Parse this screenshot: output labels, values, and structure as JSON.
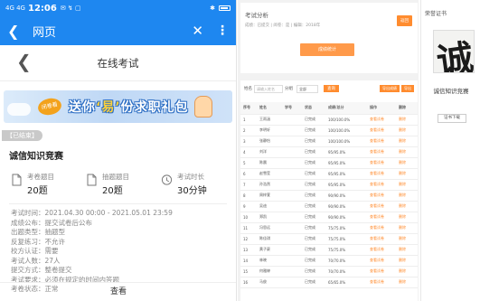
{
  "status_bar": {
    "signal": "4G 4G",
    "time": "12:06",
    "extra": "✉ ↯ ▢"
  },
  "nav": {
    "title": "网页"
  },
  "page": {
    "title": "在线考试"
  },
  "banner": {
    "tag": "闭卷看",
    "slogan_a": "送你",
    "slogan_b": "‘易’",
    "slogan_c": "份求职礼包"
  },
  "exam": {
    "status": "已结束",
    "name": "诚信知识竞赛",
    "stats": [
      {
        "label": "考卷题目",
        "value": "20",
        "unit": "题"
      },
      {
        "label": "抽题题目",
        "value": "20",
        "unit": "题"
      },
      {
        "label": "考试时长",
        "value": "30",
        "unit": "分钟"
      }
    ],
    "info": [
      "考试时间：2021.04.30 00:00 - 2021.05.01 23:59",
      "成绩公布：提交试卷后公布",
      "出题类型：抽题型",
      "反复练习：不允许",
      "校方认证：需要",
      "考试人数：27人",
      "提交方式：整卷提交",
      "考试要求：必须在规定的时间内答题",
      "考卷状态：正常"
    ],
    "view_button": "查看"
  },
  "admin": {
    "analysis_title": "考试分析",
    "analysis_sub": "成绩：已提交 | 阅卷：是 | 编辑：2018年",
    "top_button": "返回",
    "main_button": "成绩统计",
    "filter_label": "姓名",
    "filter_placeholder": "请输入姓名",
    "filter_label2": "分组",
    "filter_select": "全部",
    "search_button": "查询",
    "export_button": "导出成绩",
    "export_button2": "导出",
    "columns": [
      "序号",
      "姓名",
      "学号",
      "状态",
      "成绩/总分",
      "操作",
      "删除"
    ],
    "rows": [
      [
        "1",
        "王雨涵",
        "",
        "已完成",
        "100/100.0%",
        "查看试卷",
        "删除"
      ],
      [
        "2",
        "李明轩",
        "",
        "已完成",
        "100/100.0%",
        "查看试卷",
        "删除"
      ],
      [
        "3",
        "张静怡",
        "",
        "已完成",
        "100/100.0%",
        "查看试卷",
        "删除"
      ],
      [
        "4",
        "刘洋",
        "",
        "已完成",
        "95/95.0%",
        "查看试卷",
        "删除"
      ],
      [
        "5",
        "陈晨",
        "",
        "已完成",
        "95/95.0%",
        "查看试卷",
        "删除"
      ],
      [
        "6",
        "赵雪莹",
        "",
        "已完成",
        "95/95.0%",
        "查看试卷",
        "删除"
      ],
      [
        "7",
        "孙浩然",
        "",
        "已完成",
        "95/95.0%",
        "查看试卷",
        "删除"
      ],
      [
        "8",
        "周梓萱",
        "",
        "已完成",
        "90/90.0%",
        "查看试卷",
        "删除"
      ],
      [
        "9",
        "吴迪",
        "",
        "已完成",
        "90/90.0%",
        "查看试卷",
        "删除"
      ],
      [
        "10",
        "郑凯",
        "",
        "已完成",
        "90/90.0%",
        "查看试卷",
        "删除"
      ],
      [
        "11",
        "冯思远",
        "",
        "已完成",
        "75/75.0%",
        "查看试卷",
        "删除"
      ],
      [
        "12",
        "陈佳琪",
        "",
        "已完成",
        "75/75.0%",
        "查看试卷",
        "删除"
      ],
      [
        "13",
        "黄子豪",
        "",
        "已完成",
        "75/75.0%",
        "查看试卷",
        "删除"
      ],
      [
        "14",
        "林晓",
        "",
        "已完成",
        "70/70.0%",
        "查看试卷",
        "删除"
      ],
      [
        "15",
        "何雅婷",
        "",
        "已完成",
        "70/70.0%",
        "查看试卷",
        "删除"
      ],
      [
        "16",
        "马俊",
        "",
        "已完成",
        "65/65.0%",
        "查看试卷",
        "删除"
      ]
    ]
  },
  "certificate": {
    "title": "荣誉证书",
    "calligraphy": "诚",
    "name": "诚信知识竞赛",
    "button": "证书下载"
  },
  "colors": {
    "primary": "#1e87f0",
    "accent": "#ff8c2f"
  }
}
